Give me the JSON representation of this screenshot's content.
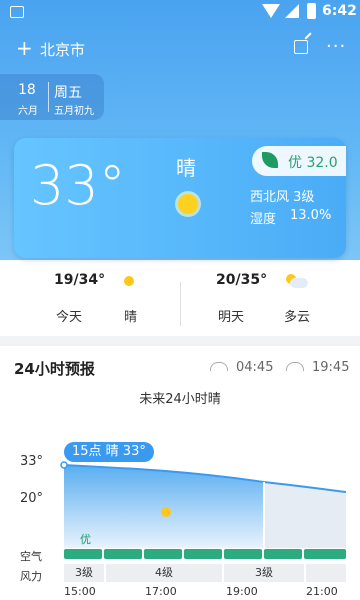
{
  "status": {
    "time": "6:42"
  },
  "header": {
    "city": "北京市",
    "add_label": "+",
    "more_label": "···"
  },
  "date": {
    "day": "18",
    "lunar_month": "六月",
    "weekday": "周五",
    "lunar_day": "五月初九"
  },
  "current": {
    "temp": "33°",
    "condition": "晴",
    "aqi": "优 32.0",
    "wind": "西北风 3级",
    "humidity_label": "湿度",
    "humidity_value": "13.0%"
  },
  "today": {
    "range": "19/34°",
    "label": "今天",
    "condition": "晴"
  },
  "tomorrow": {
    "range": "20/35°",
    "label": "明天",
    "condition": "多云"
  },
  "forecast": {
    "title": "24小时预报",
    "sunrise": "04:45",
    "sunset": "19:45",
    "subtitle": "未来24小时晴",
    "tooltip": "15点 晴 33°",
    "aqi_text": "优",
    "air_label": "空气",
    "wind_label": "风力",
    "winds": [
      "3级",
      "4级",
      "3级"
    ],
    "times": [
      "15:00",
      "17:00",
      "19:00",
      "21:00"
    ]
  },
  "chart_data": {
    "type": "area",
    "ylabels": [
      "33°",
      "20°"
    ],
    "x": [
      "15:00",
      "17:00",
      "19:00",
      "21:00"
    ],
    "values": [
      33,
      32,
      31,
      30
    ]
  },
  "colors": {
    "accent": "#4aa3f0",
    "aqi": "#2bab7f",
    "sun": "#ffc71a"
  }
}
